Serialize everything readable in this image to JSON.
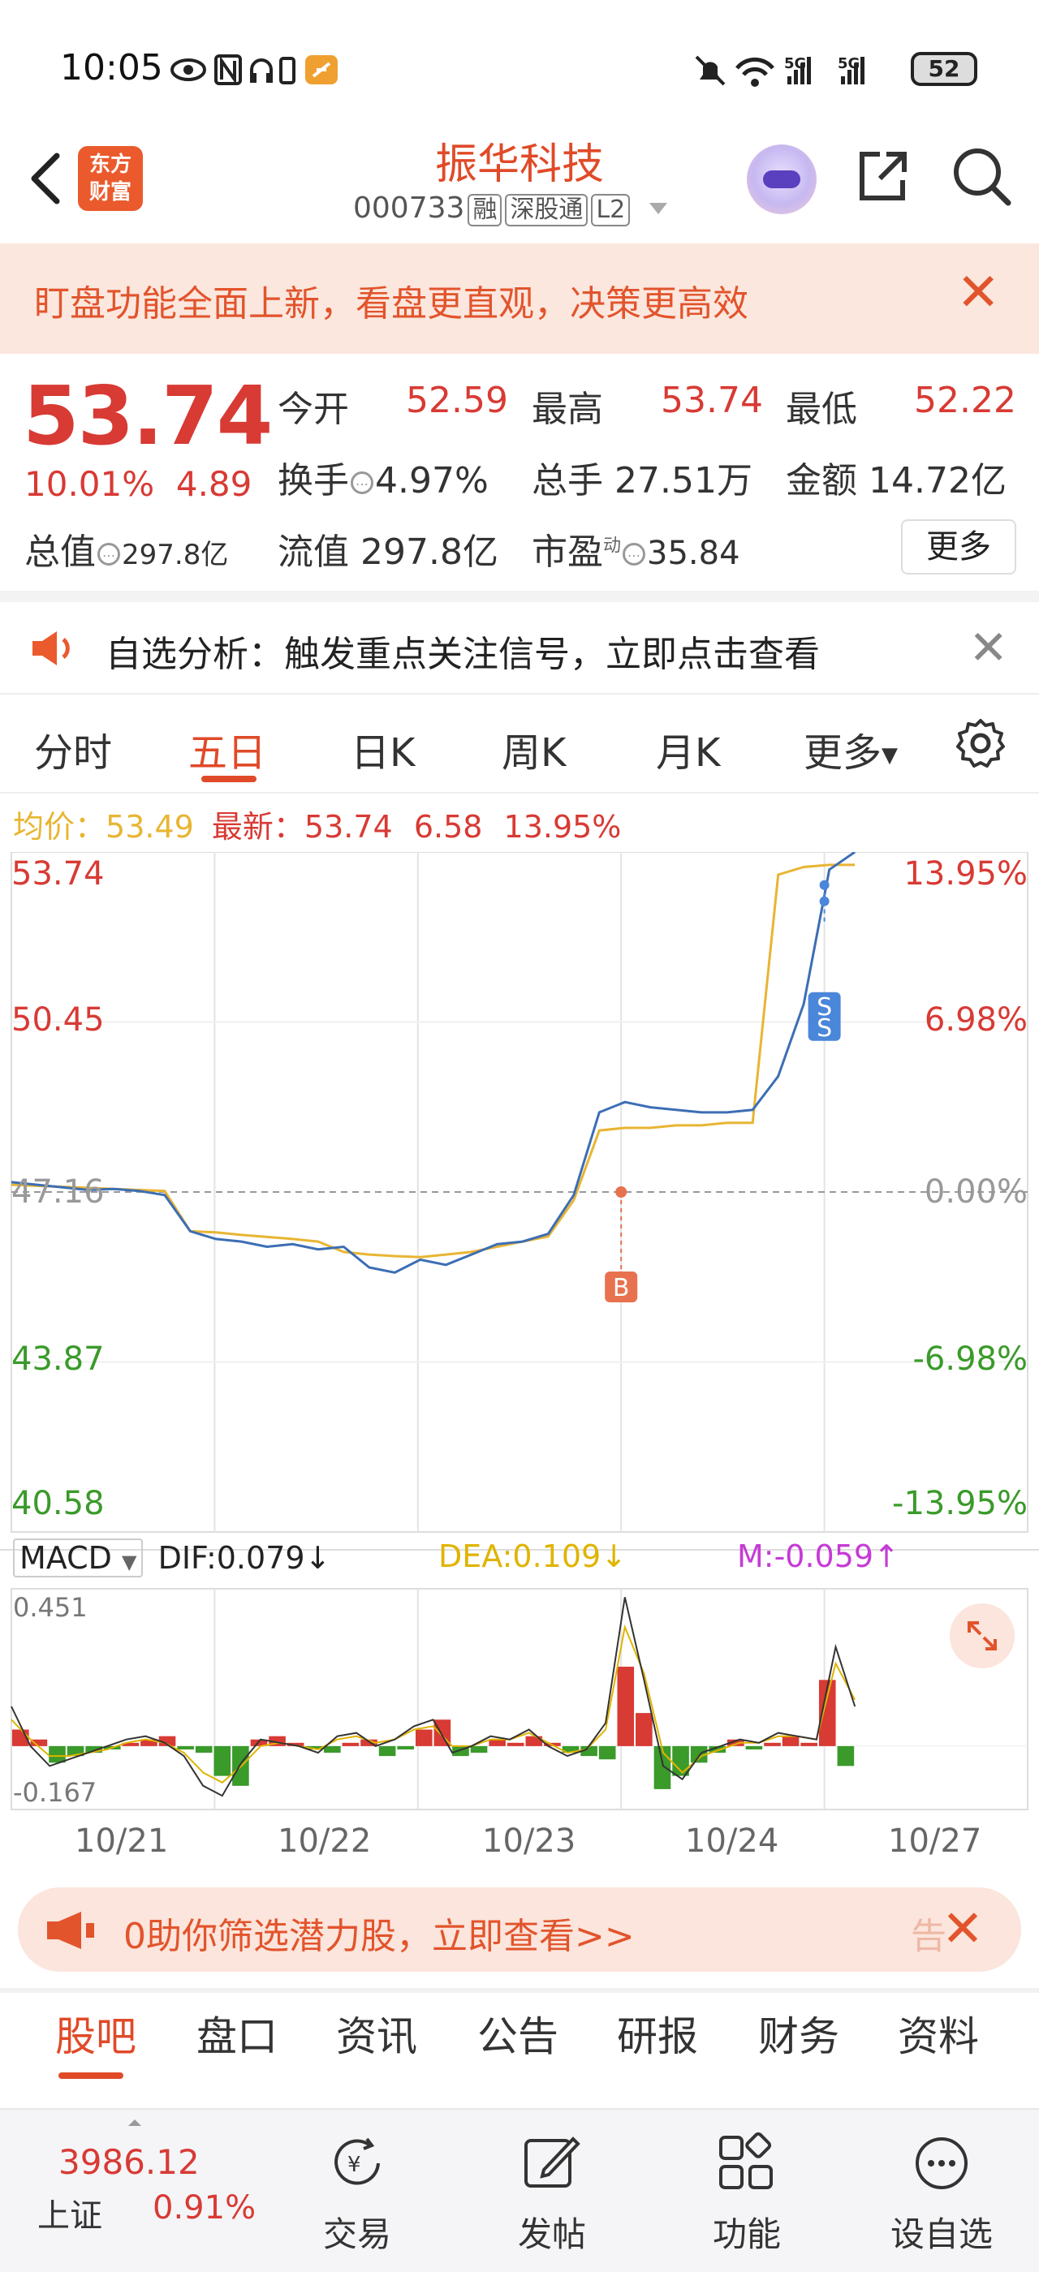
{
  "status": {
    "time": "10:05",
    "battery": "52",
    "network": "5G"
  },
  "header": {
    "back_icon": "chevron-left-icon",
    "logo_line1": "东方",
    "logo_line2": "财富",
    "title": "振华科技",
    "code": "000733",
    "tag_margin": "融",
    "tag_connect": "深股通",
    "tag_level": "L2"
  },
  "banner": {
    "text": "盯盘功能全面上新，看盘更直观，决策更高效"
  },
  "quote": {
    "price": "53.74",
    "change_pct": "10.01%",
    "change_amt": "4.89",
    "open_label": "今开",
    "open": "52.59",
    "high_label": "最高",
    "high": "53.74",
    "low_label": "最低",
    "low": "52.22",
    "turnover_label": "换手",
    "turnover": "4.97%",
    "volume_label": "总手",
    "volume": "27.51万",
    "amount_label": "金额",
    "amount": "14.72亿",
    "total_cap_label": "总值",
    "total_cap": "297.8亿",
    "float_cap_label": "流值",
    "float_cap": "297.8亿",
    "pe_label": "市盈",
    "pe_sup": "动",
    "pe": "35.84",
    "more_label": "更多"
  },
  "notice": {
    "text": "自选分析：触发重点关注信号，立即点击查看"
  },
  "tabs": {
    "items": [
      "分时",
      "五日",
      "日K",
      "周K",
      "月K",
      "更多"
    ],
    "active": "五日"
  },
  "avg": {
    "avg_label": "均价：",
    "avg_value": "53.49",
    "latest_label": "最新：",
    "latest_value": "53.74",
    "latest_change": "6.58",
    "latest_pct": "13.95%"
  },
  "chart_data": {
    "type": "line",
    "title": "",
    "y_left_ticks": [
      "53.74",
      "50.45",
      "47.16",
      "43.87",
      "40.58"
    ],
    "y_right_ticks": [
      "13.95%",
      "6.98%",
      "0.00%",
      "-6.98%",
      "-13.95%"
    ],
    "ylim": [
      40.58,
      53.74
    ],
    "x_labels": [
      "10/21",
      "10/22",
      "10/23",
      "10/24",
      "10/27"
    ],
    "baseline": 47.16,
    "price_series": [
      47.35,
      47.3,
      47.25,
      47.2,
      47.22,
      47.18,
      47.1,
      46.4,
      46.25,
      46.2,
      46.1,
      46.15,
      46.05,
      46.1,
      45.7,
      45.6,
      45.85,
      45.75,
      45.95,
      46.15,
      46.2,
      46.35,
      47.1,
      48.7,
      48.9,
      48.8,
      48.75,
      48.7,
      48.7,
      48.75,
      49.4,
      50.8,
      53.4,
      53.74
    ],
    "avg_series": [
      47.3,
      47.28,
      47.26,
      47.24,
      47.22,
      47.2,
      47.18,
      46.4,
      46.38,
      46.33,
      46.29,
      46.25,
      46.2,
      46.0,
      45.95,
      45.92,
      45.9,
      45.95,
      46.0,
      46.1,
      46.2,
      46.3,
      47.0,
      48.35,
      48.4,
      48.4,
      48.45,
      48.45,
      48.5,
      48.5,
      53.3,
      53.45,
      53.49,
      53.49
    ],
    "markers": [
      {
        "label": "B",
        "color": "#e8724f"
      },
      {
        "label": "S",
        "color": "#4a86d9"
      }
    ]
  },
  "macd": {
    "name": "MACD",
    "dif": "DIF:0.079",
    "dea": "DEA:0.109",
    "m": "M:-0.059",
    "top_tick": "0.451",
    "bottom_tick": "-0.167",
    "ylim": [
      -0.167,
      0.451
    ],
    "histogram": [
      0.05,
      0.02,
      -0.05,
      -0.03,
      -0.02,
      -0.01,
      0.01,
      0.02,
      0.03,
      -0.01,
      -0.02,
      -0.09,
      -0.12,
      0.02,
      0.03,
      0.01,
      -0.01,
      -0.02,
      0.01,
      0.02,
      -0.03,
      -0.01,
      0.05,
      0.08,
      -0.03,
      -0.02,
      0.02,
      0.01,
      0.03,
      0.01,
      -0.02,
      -0.03,
      -0.04,
      0.24,
      0.1,
      -0.13,
      -0.09,
      -0.05,
      -0.02,
      0.02,
      -0.01,
      0.01,
      0.03,
      0.01,
      0.2,
      -0.06
    ],
    "dif_series": [
      0.12,
      0.0,
      -0.06,
      -0.04,
      -0.02,
      0.0,
      0.02,
      0.03,
      0.01,
      -0.03,
      -0.12,
      -0.15,
      -0.05,
      0.02,
      0.01,
      0.0,
      -0.02,
      0.03,
      0.04,
      0.0,
      0.02,
      0.06,
      0.08,
      -0.02,
      0.0,
      0.03,
      0.02,
      0.05,
      0.0,
      -0.03,
      -0.01,
      0.07,
      0.45,
      0.2,
      -0.06,
      -0.1,
      -0.02,
      0.0,
      0.02,
      0.01,
      0.04,
      0.03,
      0.02,
      0.3,
      0.12
    ],
    "dea_series": [
      0.08,
      0.02,
      -0.03,
      -0.03,
      -0.02,
      -0.01,
      0.01,
      0.02,
      0.01,
      -0.02,
      -0.08,
      -0.11,
      -0.06,
      0.0,
      0.01,
      0.0,
      -0.01,
      0.02,
      0.03,
      0.01,
      0.02,
      0.05,
      0.06,
      0.0,
      0.0,
      0.02,
      0.02,
      0.04,
      0.01,
      -0.02,
      -0.01,
      0.05,
      0.36,
      0.22,
      -0.02,
      -0.08,
      -0.03,
      -0.01,
      0.01,
      0.01,
      0.03,
      0.03,
      0.02,
      0.25,
      0.14
    ]
  },
  "ad": {
    "text": "0助你筛选潜力股，立即查看>>",
    "tail": "告"
  },
  "bottom_tabs": {
    "items": [
      "股吧",
      "盘口",
      "资讯",
      "公告",
      "研报",
      "财务",
      "资料"
    ],
    "active": "股吧"
  },
  "nav": {
    "index_value": "3986.12",
    "index_name": "上证",
    "index_pct": "0.91%",
    "trade": "交易",
    "post": "发帖",
    "func": "功能",
    "watch": "设自选"
  },
  "colors": {
    "accent": "#e04a28",
    "up": "#d83a34",
    "down": "#3a9a2a",
    "price_line": "#3c6eb4",
    "avg_line": "#e8b533",
    "macd_dea": "#e0b400",
    "macd_m": "#c63ad6"
  }
}
